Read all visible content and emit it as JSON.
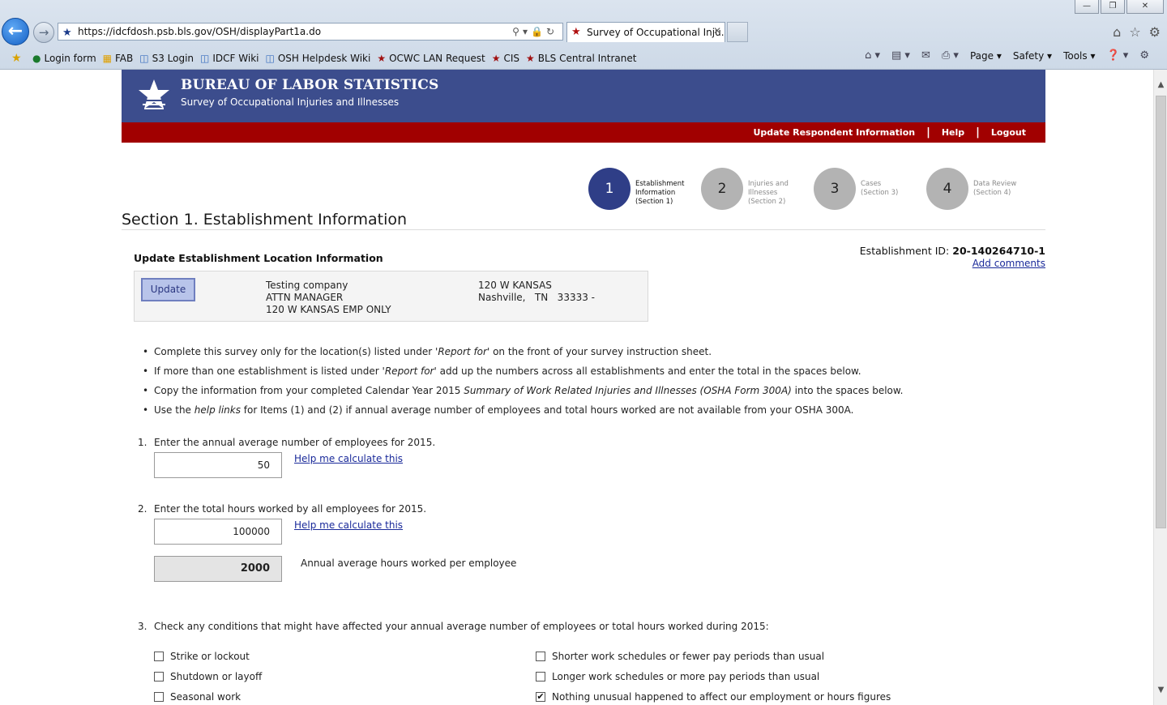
{
  "browser": {
    "url": "https://idcfdosh.psb.bls.gov/OSH/displayPart1a.do",
    "tab_title": "Survey of Occupational Inju...",
    "favorites": [
      {
        "label": "Login form",
        "icon": "globe-icon"
      },
      {
        "label": "FAB",
        "icon": "grid-icon"
      },
      {
        "label": "S3 Login",
        "icon": "page-icon"
      },
      {
        "label": "IDCF Wiki",
        "icon": "page-icon"
      },
      {
        "label": "OSH Helpdesk Wiki",
        "icon": "page-icon"
      },
      {
        "label": "OCWC LAN Request",
        "icon": "star-icon"
      },
      {
        "label": "CIS",
        "icon": "star-icon"
      },
      {
        "label": "BLS Central Intranet",
        "icon": "star-icon"
      }
    ],
    "commands": {
      "page": "Page",
      "safety": "Safety",
      "tools": "Tools"
    }
  },
  "header": {
    "title": "BUREAU OF LABOR STATISTICS",
    "subtitle": "Survey of Occupational Injuries and Illnesses",
    "links": {
      "update": "Update Respondent Information",
      "help": "Help",
      "logout": "Logout"
    }
  },
  "steps": [
    {
      "num": "1",
      "line1": "Establishment",
      "line2": "Information",
      "line3": "(Section 1)"
    },
    {
      "num": "2",
      "line1": "Injuries and",
      "line2": "Illnesses",
      "line3": "(Section 2)"
    },
    {
      "num": "3",
      "line1": "Cases",
      "line2": "(Section 3)",
      "line3": ""
    },
    {
      "num": "4",
      "line1": "Data Review",
      "line2": "(Section 4)",
      "line3": ""
    }
  ],
  "section": {
    "title": "Section 1. Establishment Information",
    "update_title": "Update Establishment Location Information",
    "est_id_label": "Establishment ID:",
    "est_id": "20-140264710-1",
    "add_comments": "Add comments",
    "update_button": "Update",
    "company": "Testing company",
    "attn": "ATTN MANAGER",
    "addr_line": "120 W KANSAS EMP ONLY",
    "street": "120 W KANSAS",
    "city_state_zip": "Nashville,   TN   33333 -"
  },
  "bullets": {
    "b1_a": "Complete this survey only for the location(s) listed under ",
    "b1_i": "'Report for'",
    "b1_b": " on the front of your survey instruction sheet.",
    "b2_a": "If more than one establishment is listed under ",
    "b2_i": "'Report for'",
    "b2_b": " add up the numbers across all establishments and enter the total in the spaces below.",
    "b3_a": "Copy the information from your completed Calendar Year 2015 ",
    "b3_i": "Summary of Work Related Injuries and Illnesses (OSHA Form 300A)",
    "b3_b": " into the spaces below.",
    "b4_a": "Use the ",
    "b4_i": "help links",
    "b4_b": " for Items (1) and (2) if annual average number of employees and total hours worked are not available from your OSHA 300A."
  },
  "q1": {
    "num": "1.",
    "label": "Enter the annual average number of employees for 2015.",
    "value": "50",
    "help": "Help me calculate this"
  },
  "q2": {
    "num": "2.",
    "label": "Enter the total hours worked by all employees for 2015.",
    "value": "100000",
    "help": "Help me calculate this",
    "avg_value": "2000",
    "avg_label": "Annual average hours worked per employee"
  },
  "q3": {
    "num": "3.",
    "label": "Check any conditions that might have affected your annual average number of employees or total hours worked during 2015:",
    "options": [
      {
        "label": "Strike or lockout",
        "checked": false
      },
      {
        "label": "Shutdown or layoff",
        "checked": false
      },
      {
        "label": "Seasonal work",
        "checked": false
      },
      {
        "label": "Shorter work schedules or fewer pay periods than usual",
        "checked": false
      },
      {
        "label": "Longer work schedules or more pay periods than usual",
        "checked": false
      },
      {
        "label": "Nothing unusual happened to affect our employment or hours figures",
        "checked": true
      }
    ]
  }
}
